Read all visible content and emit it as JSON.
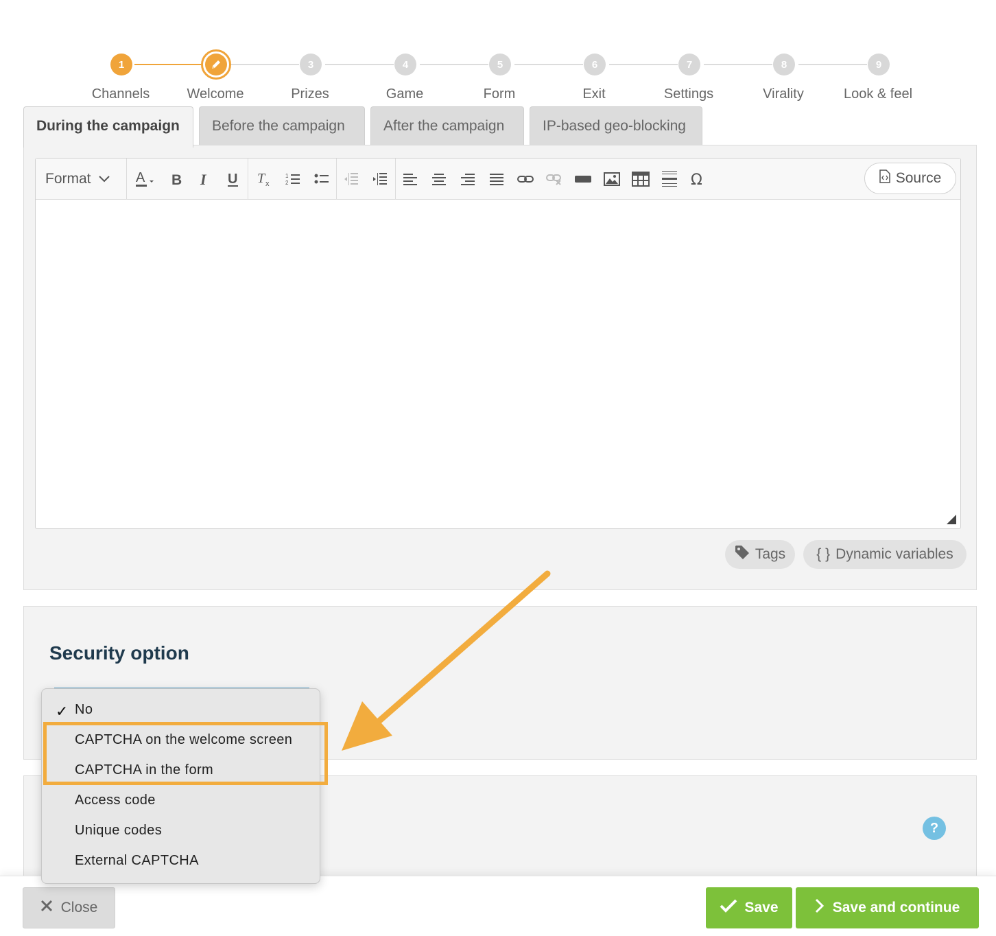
{
  "stepper": {
    "steps": [
      {
        "number": "1",
        "label": "Channels",
        "state": "done"
      },
      {
        "number": "2",
        "label": "Welcome",
        "state": "current"
      },
      {
        "number": "3",
        "label": "Prizes",
        "state": "pending"
      },
      {
        "number": "4",
        "label": "Game",
        "state": "pending"
      },
      {
        "number": "5",
        "label": "Form",
        "state": "pending"
      },
      {
        "number": "6",
        "label": "Exit",
        "state": "pending"
      },
      {
        "number": "7",
        "label": "Settings",
        "state": "pending"
      },
      {
        "number": "8",
        "label": "Virality",
        "state": "pending"
      },
      {
        "number": "9",
        "label": "Look & feel",
        "state": "pending"
      }
    ]
  },
  "tabs": [
    {
      "label": "During the campaign",
      "active": true
    },
    {
      "label": "Before the campaign",
      "active": false
    },
    {
      "label": "After the campaign",
      "active": false
    },
    {
      "label": "IP-based geo-blocking",
      "active": false
    }
  ],
  "editor": {
    "format_label": "Format",
    "source_label": "Source"
  },
  "editor_actions": {
    "tags_label": "Tags",
    "dynamic_variables_label": "Dynamic variables",
    "dynamic_variables_icon": "{ }"
  },
  "security": {
    "title": "Security option",
    "options": [
      {
        "label": "No",
        "selected": true
      },
      {
        "label": "CAPTCHA on the welcome screen",
        "selected": false
      },
      {
        "label": "CAPTCHA in the form",
        "selected": false
      },
      {
        "label": "Access code",
        "selected": false
      },
      {
        "label": "Unique codes",
        "selected": false
      },
      {
        "label": "External CAPTCHA",
        "selected": false
      }
    ],
    "check_mark": "✓"
  },
  "help": {
    "label": "?"
  },
  "footer": {
    "close_label": "Close",
    "save_label": "Save",
    "save_continue_label": "Save and continue"
  },
  "colors": {
    "accent_orange": "#f0a43a",
    "save_green": "#7dc13a",
    "title_navy": "#1f3a4d",
    "help_blue": "#74c0e2"
  }
}
